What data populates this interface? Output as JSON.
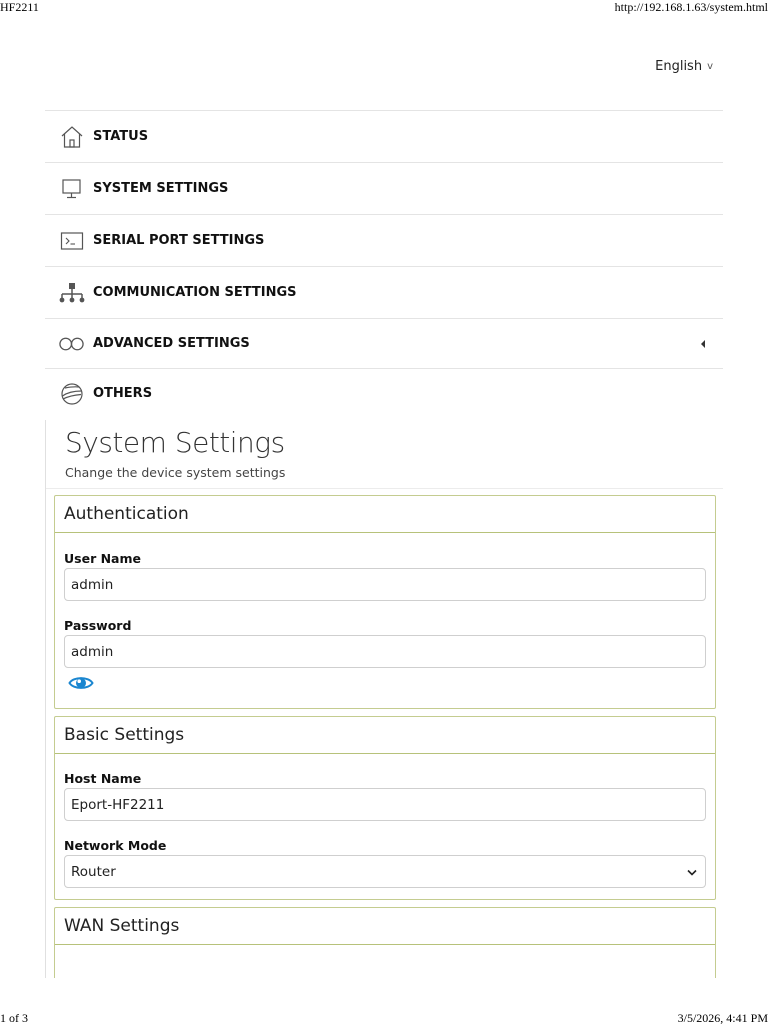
{
  "print_header": {
    "title": "HF2211",
    "url": "http://192.168.1.63/system.html"
  },
  "print_footer": {
    "page": "1 of 3",
    "datetime": "3/5/2026, 4:41 PM"
  },
  "language": {
    "selected": "English",
    "icon": "chevron-down-icon"
  },
  "nav": {
    "items": [
      {
        "label": "STATUS",
        "icon": "home-icon"
      },
      {
        "label": "SYSTEM SETTINGS",
        "icon": "monitor-icon"
      },
      {
        "label": "SERIAL PORT SETTINGS",
        "icon": "terminal-icon"
      },
      {
        "label": "COMMUNICATION SETTINGS",
        "icon": "network-icon"
      },
      {
        "label": "ADVANCED SETTINGS",
        "icon": "infinity-icon",
        "has_submenu": true
      },
      {
        "label": "OTHERS",
        "icon": "globe-icon"
      }
    ]
  },
  "page": {
    "title": "System Settings",
    "subtitle": "Change the device system settings"
  },
  "authentication": {
    "heading": "Authentication",
    "username_label": "User Name",
    "username_value": "admin",
    "password_label": "Password",
    "password_value": "admin",
    "show_password_icon": "eye-icon"
  },
  "basic_settings": {
    "heading": "Basic Settings",
    "hostname_label": "Host Name",
    "hostname_value": "Eport-HF2211",
    "network_mode_label": "Network Mode",
    "network_mode_value": "Router"
  },
  "wan_settings": {
    "heading": "WAN Settings"
  },
  "colors": {
    "panel_border": "#c4cc90",
    "eye_icon": "#1a86d0"
  }
}
